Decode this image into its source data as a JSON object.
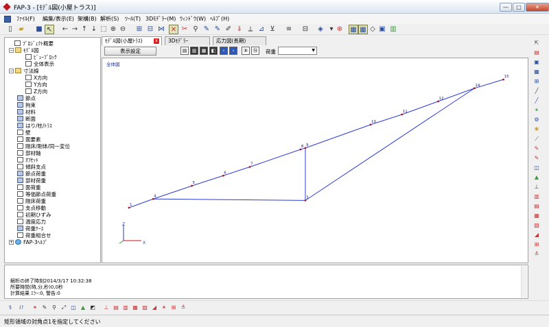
{
  "window": {
    "title": "FAP-3 - [ﾓﾃﾞﾙ図(小屋トラス)]",
    "min": "—",
    "max": "□",
    "close": "✕",
    "mdi_min": "_",
    "mdi_max": "▫",
    "mdi_close": "x"
  },
  "menu": [
    "ﾌｧｲﾙ(F)",
    "編集/表示(E)",
    "架構(B)",
    "解析(S)",
    "ﾂｰﾙ(T)",
    "3Dﾓﾃﾞﾗｰ(M)",
    "ｳｨﾝﾄﾞｳ(W)",
    "ﾍﾙﾌﾟ(H)"
  ],
  "tree": [
    {
      "label": "ﾌﾟﾛｼﾞｪｸﾄ概要",
      "icon": "doc"
    },
    {
      "label": "ﾓﾃﾞﾙ図",
      "icon": "folder",
      "expander": "−"
    },
    {
      "label": "ﾋﾞｭｰﾌﾞﾛｯｸ",
      "icon": "doc"
    },
    {
      "label": "全体表示",
      "icon": "doc"
    },
    {
      "label": "寸法線",
      "icon": "folder",
      "expander": "−"
    },
    {
      "label": "X方向",
      "icon": "doc"
    },
    {
      "label": "Y方向",
      "icon": "doc"
    },
    {
      "label": "Z方向",
      "icon": "doc"
    },
    {
      "label": "節点",
      "icon": "blue"
    },
    {
      "label": "拘束",
      "icon": "blue"
    },
    {
      "label": "材料",
      "icon": "blue"
    },
    {
      "label": "断面",
      "icon": "blue"
    },
    {
      "label": "はり/柱/ﾄﾗｽ",
      "icon": "blue"
    },
    {
      "label": "壁",
      "icon": "doc"
    },
    {
      "label": "面要素",
      "icon": "doc"
    },
    {
      "label": "剛床/剛体/同一変位",
      "icon": "doc"
    },
    {
      "label": "部材軸",
      "icon": "doc"
    },
    {
      "label": "ｵﾌｾｯﾄ",
      "icon": "doc"
    },
    {
      "label": "傾斜支点",
      "icon": "doc"
    },
    {
      "label": "節点荷重",
      "icon": "blue"
    },
    {
      "label": "部材荷重",
      "icon": "blue"
    },
    {
      "label": "面荷重",
      "icon": "doc"
    },
    {
      "label": "等価節点荷重",
      "icon": "doc"
    },
    {
      "label": "剛床荷重",
      "icon": "doc"
    },
    {
      "label": "支点移動",
      "icon": "doc"
    },
    {
      "label": "初期ひずみ",
      "icon": "doc"
    },
    {
      "label": "温度応力",
      "icon": "doc"
    },
    {
      "label": "荷重ｹｰｽ",
      "icon": "blue"
    },
    {
      "label": "荷重組合せ",
      "icon": "doc"
    },
    {
      "label": "FAP-3ﾍﾙﾌﾟ",
      "icon": "help",
      "expander": "+"
    }
  ],
  "tabs": [
    {
      "label": "ﾓﾃﾞﾙ図(小屋ﾄﾗｽ)",
      "close": "x"
    },
    {
      "label": "3Dﾓﾃﾞﾗｰ"
    },
    {
      "label": "応力図(長期)"
    }
  ],
  "view_toolbar": {
    "display_settings": "表示設定",
    "load_label": "荷重",
    "load_value": ""
  },
  "canvas": {
    "label": "全体図"
  },
  "chart_data": {
    "type": "diagram",
    "nodes": [
      {
        "id": "1",
        "x": 0.0,
        "y": 0.0
      },
      {
        "id": "4",
        "x": 1.0,
        "y": 0.3
      },
      {
        "id": "5",
        "x": 2.6,
        "y": 0.75
      },
      {
        "id": "6",
        "x": 3.9,
        "y": 1.1
      },
      {
        "id": "7",
        "x": 5.0,
        "y": 1.4
      },
      {
        "id": "8",
        "x": 7.1,
        "y": 2.0
      },
      {
        "id": "9",
        "x": 7.3,
        "y": 2.05
      },
      {
        "id": "10",
        "x": 10.0,
        "y": 2.85
      },
      {
        "id": "11",
        "x": 11.3,
        "y": 3.2
      },
      {
        "id": "12",
        "x": 12.8,
        "y": 3.65
      },
      {
        "id": "14",
        "x": 14.3,
        "y": 4.1
      },
      {
        "id": "15",
        "x": 15.5,
        "y": 4.4
      },
      {
        "id": "3",
        "x": 7.3,
        "y": 0.25
      }
    ],
    "edges": [
      [
        "1",
        "4"
      ],
      [
        "4",
        "5"
      ],
      [
        "5",
        "6"
      ],
      [
        "6",
        "7"
      ],
      [
        "7",
        "8"
      ],
      [
        "8",
        "9"
      ],
      [
        "9",
        "10"
      ],
      [
        "10",
        "11"
      ],
      [
        "11",
        "12"
      ],
      [
        "12",
        "14"
      ],
      [
        "14",
        "15"
      ],
      [
        "4",
        "3"
      ],
      [
        "3",
        "9"
      ],
      [
        "3",
        "14"
      ]
    ],
    "axes": {
      "z": "Z",
      "x": "X"
    }
  },
  "log": {
    "lines": [
      "解析の終了時刻2014/3/17 10:32:38",
      "所要時間(時,分,秒)0,0秒",
      "計算結果 ｴﾗｰ:0, 警告:0"
    ]
  },
  "status": {
    "message": "矩形領域の対角点1を指定してください"
  }
}
